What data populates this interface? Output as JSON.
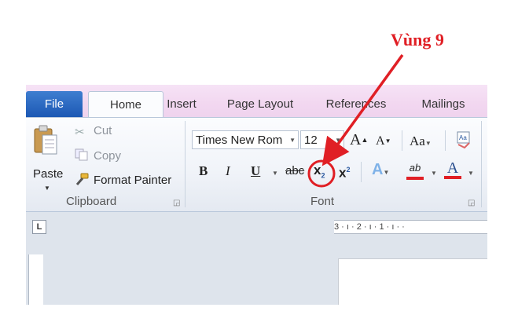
{
  "annotation": {
    "label": "Vùng 9",
    "color": "#e01f25"
  },
  "tabs": [
    "File",
    "Home",
    "Insert",
    "Page Layout",
    "References",
    "Mailings"
  ],
  "clipboard": {
    "paste_label": "Paste",
    "cut_label": "Cut",
    "copy_label": "Copy",
    "format_painter_label": "Format Painter",
    "group_label": "Clipboard"
  },
  "font": {
    "font_name": "Times New Rom",
    "font_size": "12",
    "grow_label": "A",
    "shrink_label": "A",
    "change_case_label": "Aa",
    "bold_label": "B",
    "italic_label": "I",
    "underline_label": "U",
    "strikethrough_label": "abc",
    "subscript_label": "x",
    "subscript_small": "2",
    "superscript_label": "x",
    "superscript_small": "2",
    "highlight_label": "ab",
    "font_color_label": "A",
    "group_label": "Font"
  },
  "ruler": {
    "corner_label": "L",
    "marks": "3 · ı · 2 · ı · 1 · ı · ·"
  },
  "colors": {
    "file_tab": "#2b6cc4",
    "accent_red": "#e01f25"
  }
}
